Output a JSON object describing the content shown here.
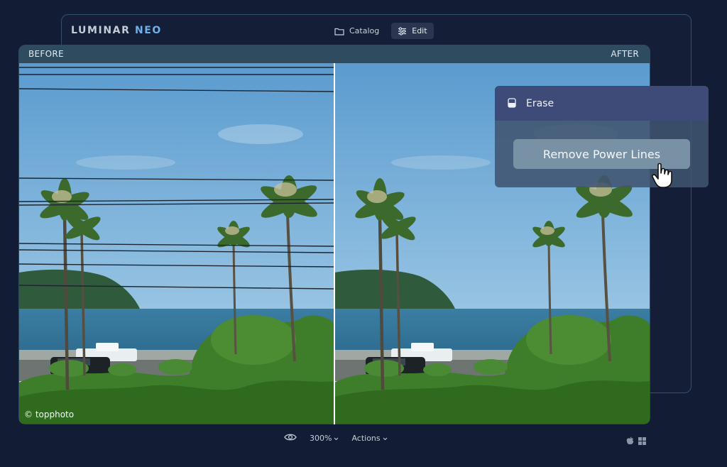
{
  "app": {
    "name_part1": "LUMINAR",
    "name_part2": "NEO"
  },
  "topnav": {
    "catalog_label": "Catalog",
    "edit_label": "Edit"
  },
  "compare": {
    "before_label": "BEFORE",
    "after_label": "AFTER",
    "watermark": "© topphoto"
  },
  "erase_panel": {
    "title": "Erase",
    "button_label": "Remove Power Lines"
  },
  "bottom": {
    "zoom": "300%",
    "actions_label": "Actions"
  },
  "icons": [
    "folder-icon",
    "sliders-icon",
    "eraser-icon",
    "hand-pointer-icon",
    "eye-icon",
    "chevron-down-icon",
    "apple-icon",
    "windows-icon"
  ],
  "colors": {
    "background": "#131c35",
    "accent": "#6fb1ea",
    "panel": "#3e4b78"
  }
}
